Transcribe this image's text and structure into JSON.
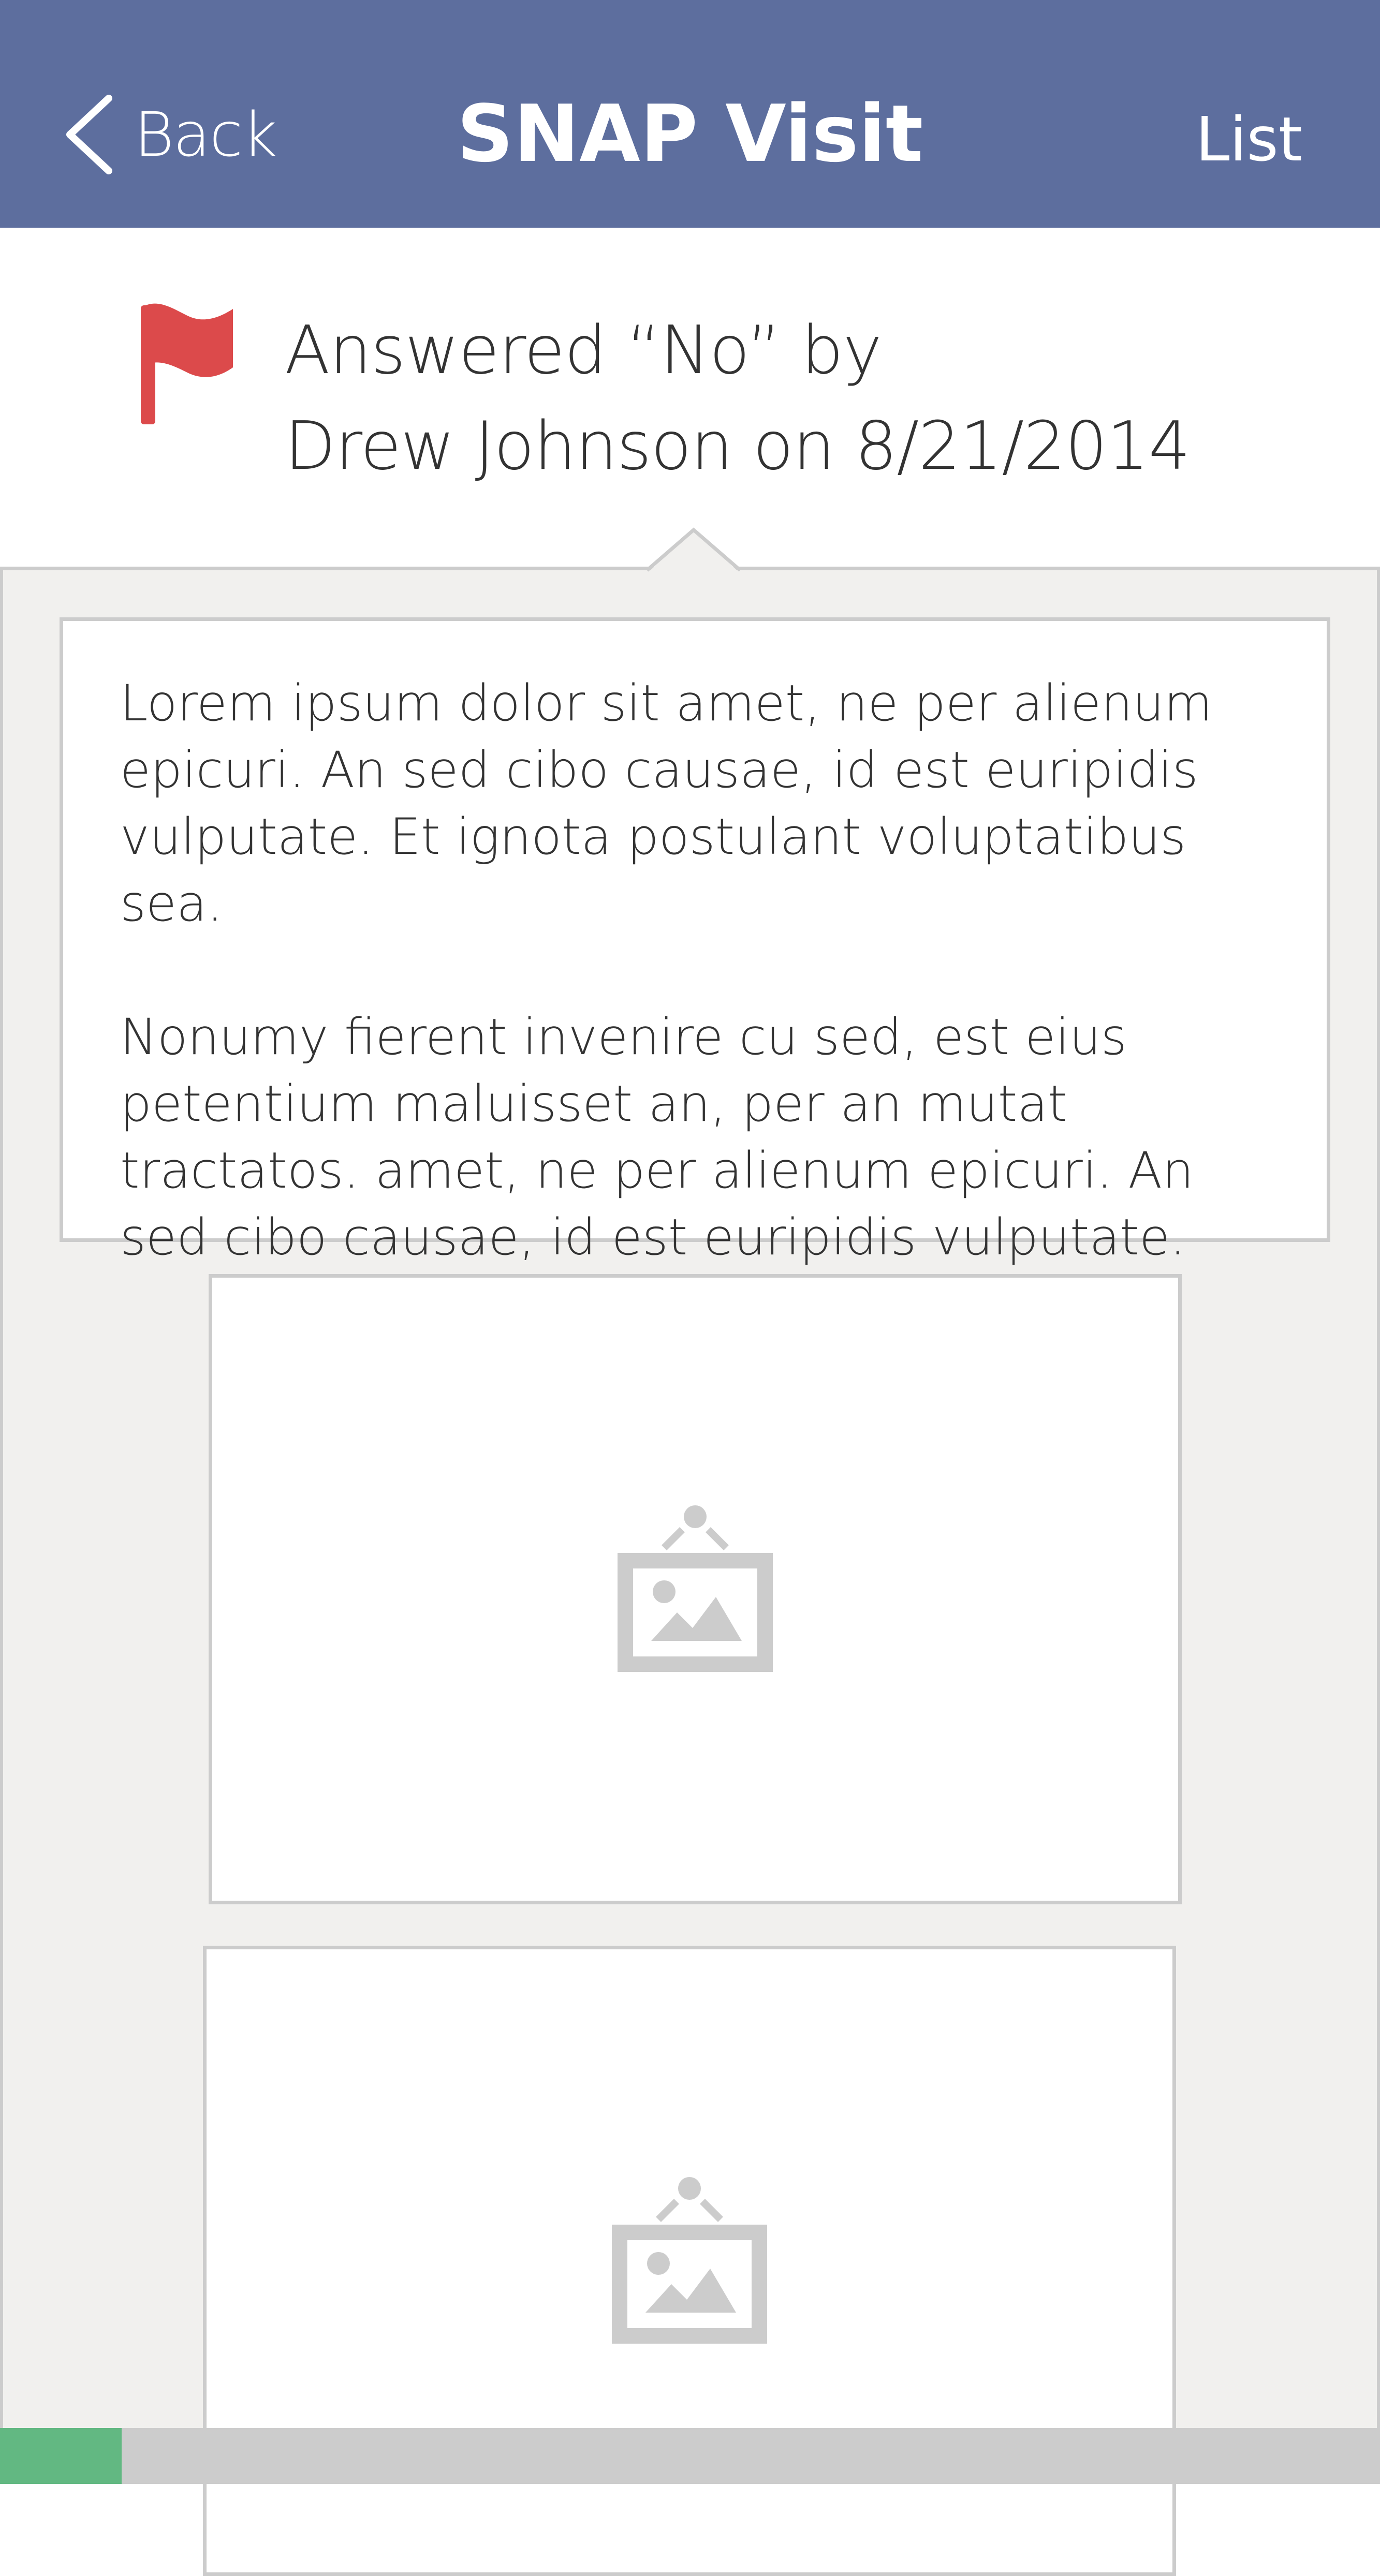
{
  "header": {
    "back_label": "Back",
    "title": "SNAP Visit",
    "list_label": "List",
    "background_color": "#5d6e9e"
  },
  "answer": {
    "icon": "flag-icon",
    "flag_color": "#dc4a4b",
    "line1": "Answered “No” by",
    "line2": "Drew Johnson on 8/21/2014"
  },
  "comment": {
    "paragraphs": [
      "Lorem ipsum dolor sit amet, ne per alienum epicuri. An sed cibo causae, id est euripidis vulputate. Et ignota postulant voluptatibus sea.",
      "Nonumy fierent invenire cu sed, est eius petentium maluisset an, per an mutat tractatos. amet, ne per alienum epicuri. An sed cibo causae, id est euripidis vulputate."
    ]
  },
  "images": [
    {
      "icon": "image-placeholder-icon"
    },
    {
      "icon": "image-placeholder-icon"
    }
  ],
  "progress": {
    "percent": 8.8,
    "fill_color": "#62b882"
  }
}
